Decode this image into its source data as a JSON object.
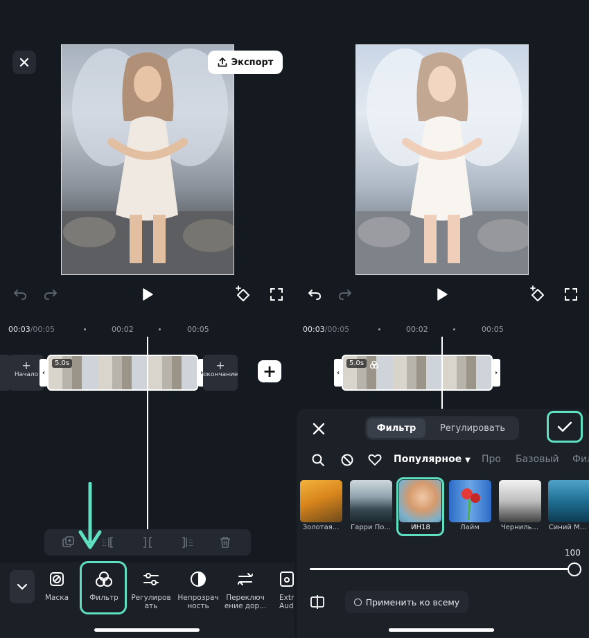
{
  "accent_color": "#5fe0c0",
  "left": {
    "close_icon": "close-icon",
    "export_label": "Экспорт",
    "timecode_current": "00:03",
    "timecode_total": "/00:05",
    "ticks": [
      "00:02",
      "00:05"
    ],
    "clip_duration": "5.0s",
    "transition_start": "Начало",
    "transition_end": "окончание",
    "bottom_tools": [
      {
        "icon": "mask-icon",
        "label": "Маска"
      },
      {
        "icon": "filter-icon",
        "label": "Фильтр"
      },
      {
        "icon": "adjust-icon",
        "label": "Регулировать"
      },
      {
        "icon": "opacity-icon",
        "label": "Непрозрачность"
      },
      {
        "icon": "switch-icon",
        "label": "Переключение дор..."
      },
      {
        "icon": "extract-audio-icon",
        "label": "Extr Aud"
      }
    ]
  },
  "right": {
    "timecode_current": "00:03",
    "timecode_total": "/00:05",
    "ticks": [
      "00:02",
      "00:05"
    ],
    "clip_duration": "5.0s",
    "tabs": [
      {
        "label": "Фильтр",
        "active": true
      },
      {
        "label": "Регулировать",
        "active": false
      }
    ],
    "categories": [
      "Популярное",
      "Про",
      "Базовый",
      "Фил"
    ],
    "filters": [
      {
        "label": "Золотая...",
        "selected": false
      },
      {
        "label": "Гарри По...",
        "selected": false
      },
      {
        "label": "ИН18",
        "selected": true
      },
      {
        "label": "Лайм",
        "selected": false
      },
      {
        "label": "Черниль...",
        "selected": false
      },
      {
        "label": "Синий М...",
        "selected": false
      }
    ],
    "intensity": "100",
    "apply_all_label": "Применить ко всему"
  }
}
